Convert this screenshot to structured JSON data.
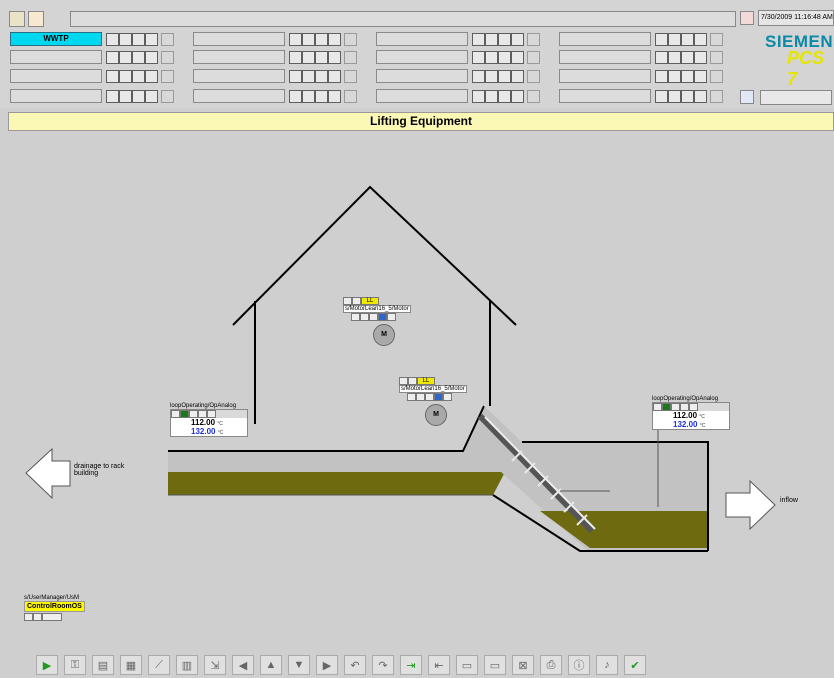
{
  "header": {
    "area_button": "WWTP",
    "datetime": "7/30/2009 11:16:48 AM",
    "brand": "SIEMENS",
    "product": "PCS 7"
  },
  "title": "Lifting Equipment",
  "motor1": {
    "alarm": "LL",
    "tag": "s/MotorLean16_5/Motor",
    "symbol": "M"
  },
  "motor2": {
    "alarm": "LL",
    "tag": "s/MotorLean16_5/Motor",
    "symbol": "M"
  },
  "analog_left": {
    "tag": "loopOperating/OpAnalog",
    "value1": "112.00",
    "value2": "132.00",
    "unit": "°C"
  },
  "analog_right": {
    "tag": "loopOperating/OpAnalog",
    "value1": "112.00",
    "value2": "132.00",
    "unit": "°C"
  },
  "arrows": {
    "left": "drainage to rack building",
    "right": "inflow"
  },
  "user_manager": {
    "tag": "s/UserManager/UsM",
    "label": "ControlRoomOS"
  },
  "icons": {
    "toolbar": [
      "play-icon",
      "key-icon",
      "folder-icon",
      "report-icon",
      "trend-icon",
      "thermometer-icon",
      "export-icon",
      "arrow-left-icon",
      "arrow-up-icon",
      "arrow-down-icon",
      "arrow-right-icon",
      "undo-icon",
      "redo-icon",
      "login-icon",
      "logout-icon",
      "window-icon",
      "window2-icon",
      "window-close-icon",
      "print-icon",
      "info-icon",
      "sound-icon",
      "checkmark-icon"
    ]
  }
}
